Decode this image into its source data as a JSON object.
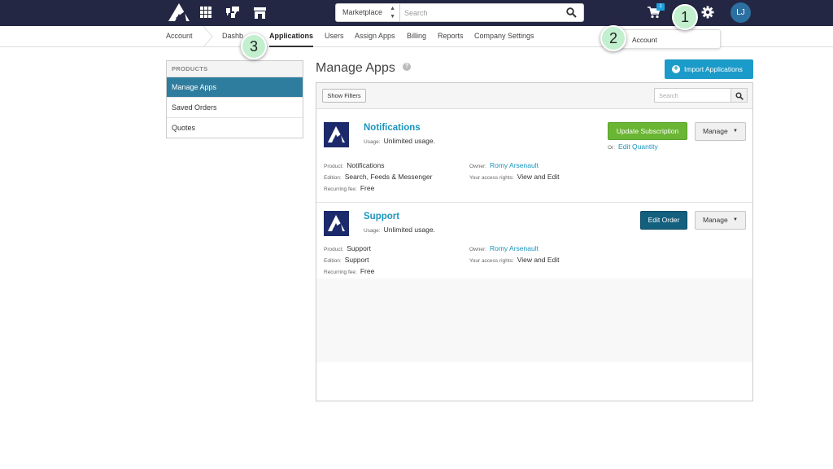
{
  "topbar": {
    "search": {
      "scope": "Marketplace",
      "placeholder": "Search"
    },
    "cart_count": "1",
    "user_initials": "LJ",
    "colors": {
      "bg": "#242744",
      "accent": "#1aa1dc"
    }
  },
  "subnav": {
    "items": [
      "Account",
      "Dashb",
      "Applications",
      "Users",
      "Assign Apps",
      "Billing",
      "Reports",
      "Company Settings"
    ],
    "active": "Applications"
  },
  "account_dropdown": {
    "label": "Account"
  },
  "callouts": [
    "1",
    "2",
    "3"
  ],
  "sidebar": {
    "header": "PRODUCTS",
    "items": [
      "Manage Apps",
      "Saved Orders",
      "Quotes"
    ],
    "active": "Manage Apps"
  },
  "main": {
    "title": "Manage Apps",
    "help": "?",
    "import_label": "Import Applications",
    "show_filters": "Show Filters",
    "search_placeholder": "Search"
  },
  "apps": [
    {
      "name": "Notifications",
      "usage_label": "Usage:",
      "usage": "Unlimited usage.",
      "product_label": "Product:",
      "product": "Notifications",
      "edition_label": "Edition:",
      "edition": "Search, Feeds & Messenger",
      "fee_label": "Recurring fee:",
      "fee": "Free",
      "owner_label": "Owner:",
      "owner": "Romy Arsenault",
      "rights_label": "Your access rights:",
      "rights": "View and Edit",
      "primary_action": "Update Subscription",
      "or_label": "Or:",
      "secondary_action": "Edit Quantity",
      "manage": "Manage"
    },
    {
      "name": "Support",
      "usage_label": "Usage:",
      "usage": "Unlimited usage.",
      "product_label": "Product:",
      "product": "Support",
      "edition_label": "Edition:",
      "edition": "Support",
      "fee_label": "Recurring fee:",
      "fee": "Free",
      "owner_label": "Owner:",
      "owner": "Romy Arsenault",
      "rights_label": "Your access rights:",
      "rights": "View and Edit",
      "primary_action": "Edit Order",
      "manage": "Manage"
    }
  ],
  "colors": {
    "link": "#1b95bd",
    "sidebar_active": "#2e7d9e",
    "update_button": "#6ab533",
    "edit_order_button": "#135f7e",
    "import_button": "#1b9bc9",
    "callout": "#c2f0cf"
  }
}
